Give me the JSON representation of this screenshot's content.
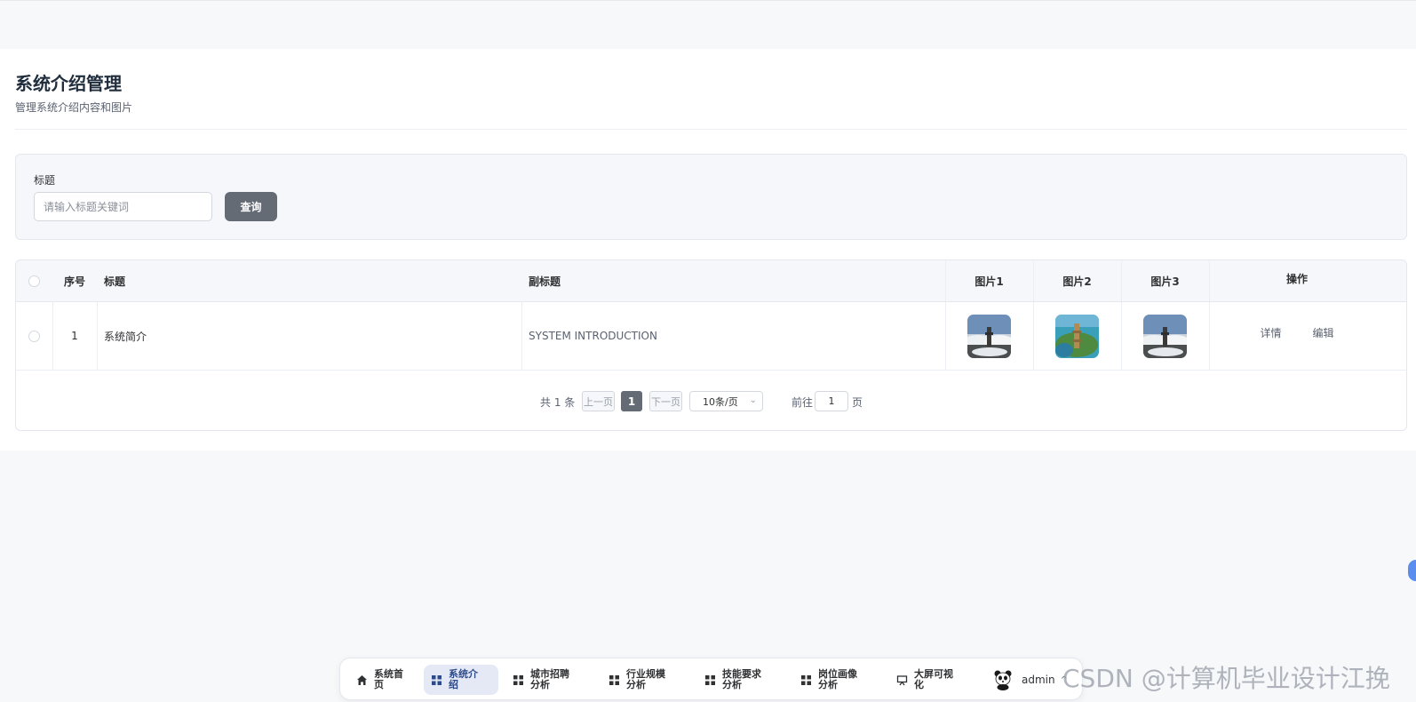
{
  "page": {
    "title": "系统介绍管理",
    "subtitle": "管理系统介绍内容和图片"
  },
  "search": {
    "label": "标题",
    "placeholder": "请输入标题关键词",
    "button": "查询"
  },
  "table": {
    "headers": {
      "index": "序号",
      "title": "标题",
      "subtitle": "副标题",
      "pic1": "图片1",
      "pic2": "图片2",
      "pic3": "图片3",
      "actions": "操作"
    },
    "rows": [
      {
        "index": "1",
        "title": "系统简介",
        "subtitle": "SYSTEM INTRODUCTION",
        "detail": "详情",
        "edit": "编辑"
      }
    ]
  },
  "pagination": {
    "total": "共 1 条",
    "prev": "上一页",
    "current": "1",
    "next": "下一页",
    "page_size": "10条/页",
    "goto_label": "前往",
    "goto_value": "1",
    "page_suffix": "页"
  },
  "nav": {
    "items": [
      {
        "label": "系统首页",
        "icon": "home-icon"
      },
      {
        "label": "系统介绍",
        "icon": "grid-icon",
        "active": true
      },
      {
        "label": "城市招聘分析",
        "icon": "grid-icon"
      },
      {
        "label": "行业规模分析",
        "icon": "grid-icon"
      },
      {
        "label": "技能要求分析",
        "icon": "grid-icon"
      },
      {
        "label": "岗位画像分析",
        "icon": "grid-icon"
      },
      {
        "label": "大屏可视化",
        "icon": "screen-icon"
      }
    ],
    "user": "admin"
  },
  "watermark": "CSDN @计算机毕业设计江挽",
  "colors": {
    "primary_button": "#646b74",
    "active_nav_bg": "#e4e9f5",
    "float_dot": "#5b8def"
  }
}
